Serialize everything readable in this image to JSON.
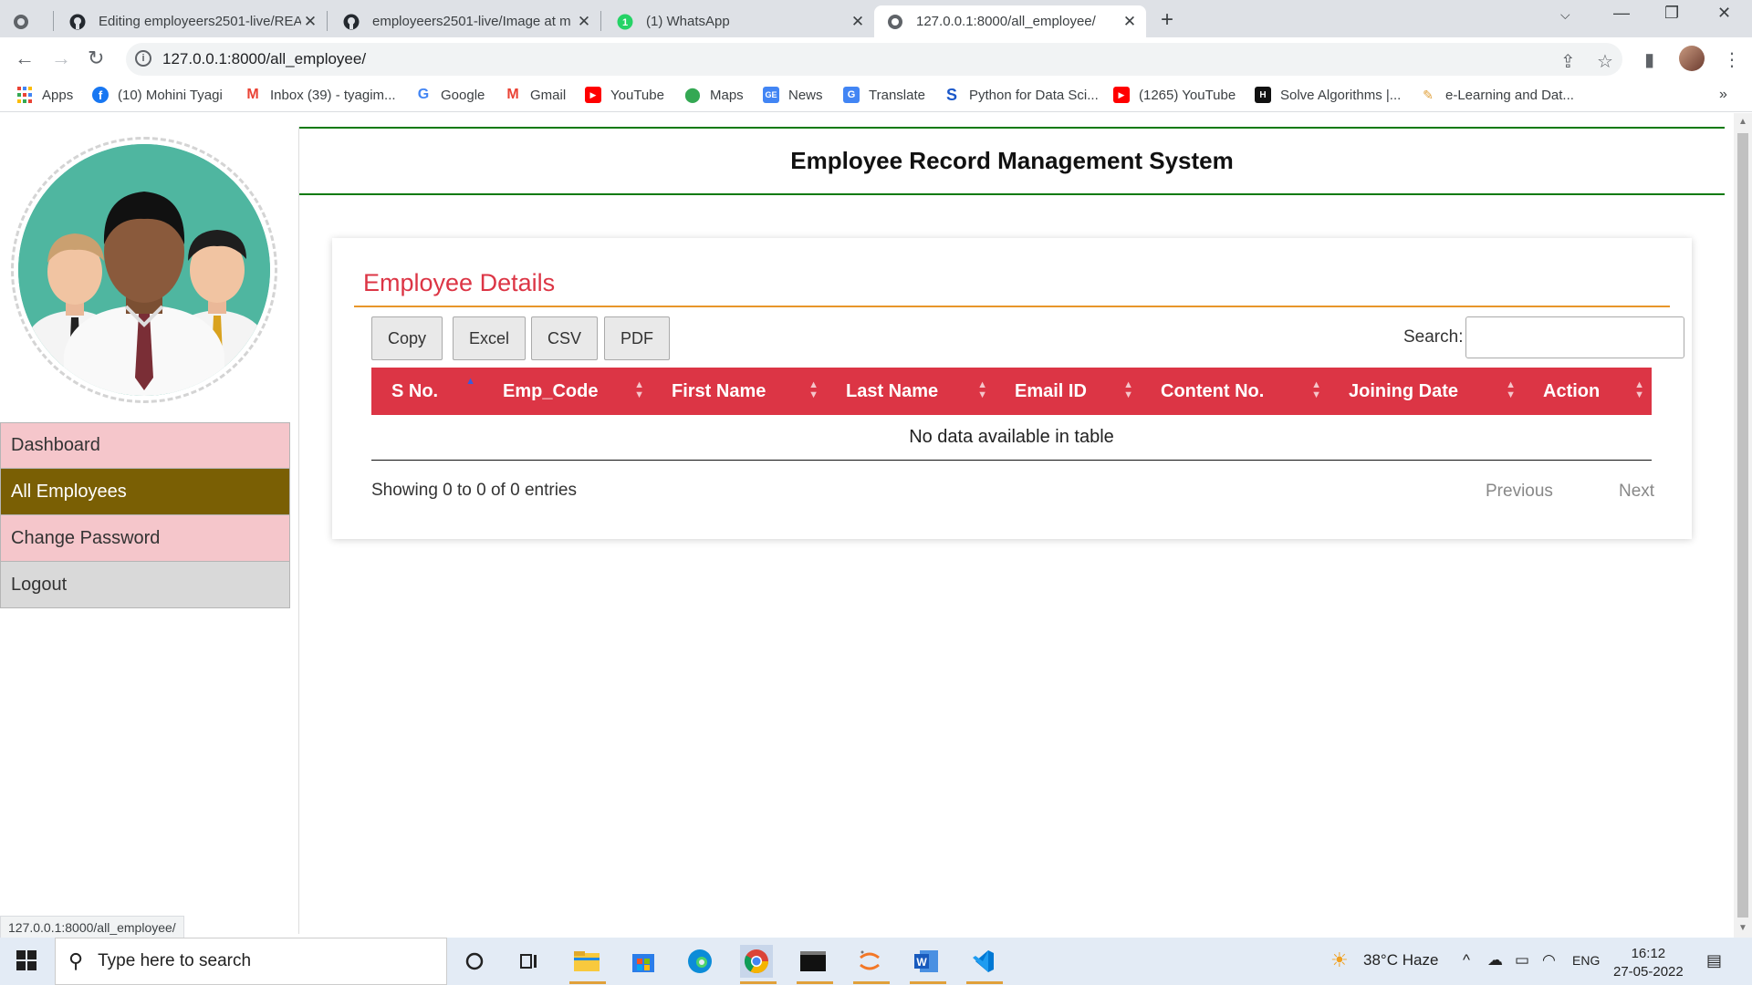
{
  "browser": {
    "tabs": [
      {
        "title": ""
      },
      {
        "title": "Editing employeers2501-live/REA"
      },
      {
        "title": "employeers2501-live/Image at m"
      },
      {
        "title": "(1) WhatsApp"
      },
      {
        "title": "127.0.0.1:8000/all_employee/"
      }
    ],
    "url": "127.0.0.1:8000/all_employee/",
    "bookmarks": [
      {
        "label": "Apps"
      },
      {
        "label": "(10) Mohini Tyagi"
      },
      {
        "label": "Inbox (39) - tyagim..."
      },
      {
        "label": "Google"
      },
      {
        "label": "Gmail"
      },
      {
        "label": "YouTube"
      },
      {
        "label": "Maps"
      },
      {
        "label": "News"
      },
      {
        "label": "Translate"
      },
      {
        "label": "Python for Data Sci..."
      },
      {
        "label": "(1265) YouTube"
      },
      {
        "label": "Solve Algorithms |..."
      },
      {
        "label": "e-Learning and Dat..."
      }
    ],
    "status_url": "127.0.0.1:8000/all_employee/"
  },
  "sidebar": {
    "items": [
      {
        "label": "Dashboard"
      },
      {
        "label": "All Employees"
      },
      {
        "label": "Change Password"
      },
      {
        "label": "Logout"
      }
    ]
  },
  "header": {
    "title": "Employee Record Management System"
  },
  "card": {
    "title": "Employee Details",
    "buttons": [
      {
        "label": "Copy"
      },
      {
        "label": "Excel"
      },
      {
        "label": "CSV"
      },
      {
        "label": "PDF"
      }
    ],
    "search_label": "Search:",
    "columns": [
      {
        "label": "S No."
      },
      {
        "label": "Emp_Code"
      },
      {
        "label": "First Name"
      },
      {
        "label": "Last Name"
      },
      {
        "label": "Email ID"
      },
      {
        "label": "Content No."
      },
      {
        "label": "Joining Date"
      },
      {
        "label": "Action"
      }
    ],
    "empty_message": "No data available in table",
    "info": "Showing 0 to 0 of 0 entries",
    "previous": "Previous",
    "next": "Next"
  },
  "taskbar": {
    "search_placeholder": "Type here to search",
    "weather": "38°C  Haze",
    "language": "ENG",
    "time": "16:12",
    "date": "27-05-2022"
  },
  "colors": {
    "accent_red": "#dc3545",
    "active_menu": "#7a5f04",
    "menu_pink": "#f5c6cb",
    "header_rule": "#0a7a0a",
    "card_rule": "#e8962a"
  }
}
